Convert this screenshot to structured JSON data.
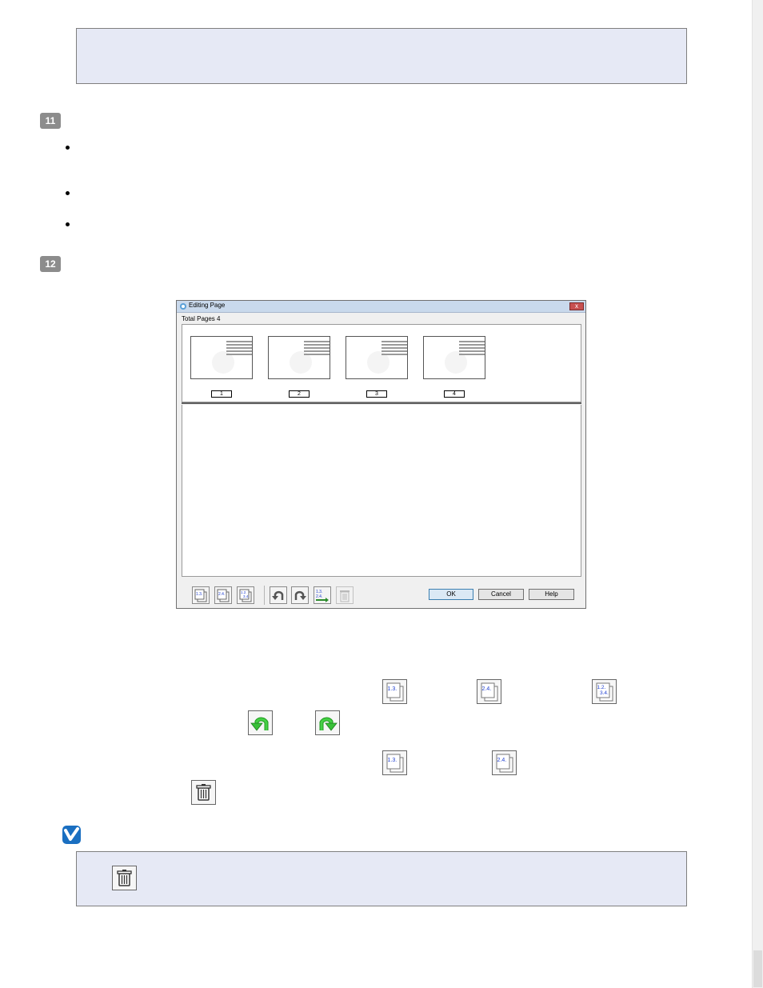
{
  "dialog": {
    "title": "Editing Page",
    "total_pages_label": "Total Pages 4",
    "close_glyph": "x",
    "thumbnails": [
      {
        "page_number": "1"
      },
      {
        "page_number": "2"
      },
      {
        "page_number": "3"
      },
      {
        "page_number": "4"
      }
    ],
    "buttons": {
      "ok": "OK",
      "cancel": "Cancel",
      "help": "Help"
    }
  },
  "steps": {
    "step11": "11",
    "step12": "12"
  },
  "icons": {
    "odd_pages": "1.3.",
    "even_pages": "2.4.",
    "all_pages": "1.2.\n3.4.",
    "all_pages_line1": "1.2.",
    "all_pages_line2": "3.4."
  },
  "colors": {
    "note_box_bg": "#e6e9f5",
    "step_badge": "#8c8c8c",
    "rotate_arrow": "#2fbf2f",
    "page_number_blue": "#1f3fd0",
    "note_check": "#1a6fc1"
  }
}
